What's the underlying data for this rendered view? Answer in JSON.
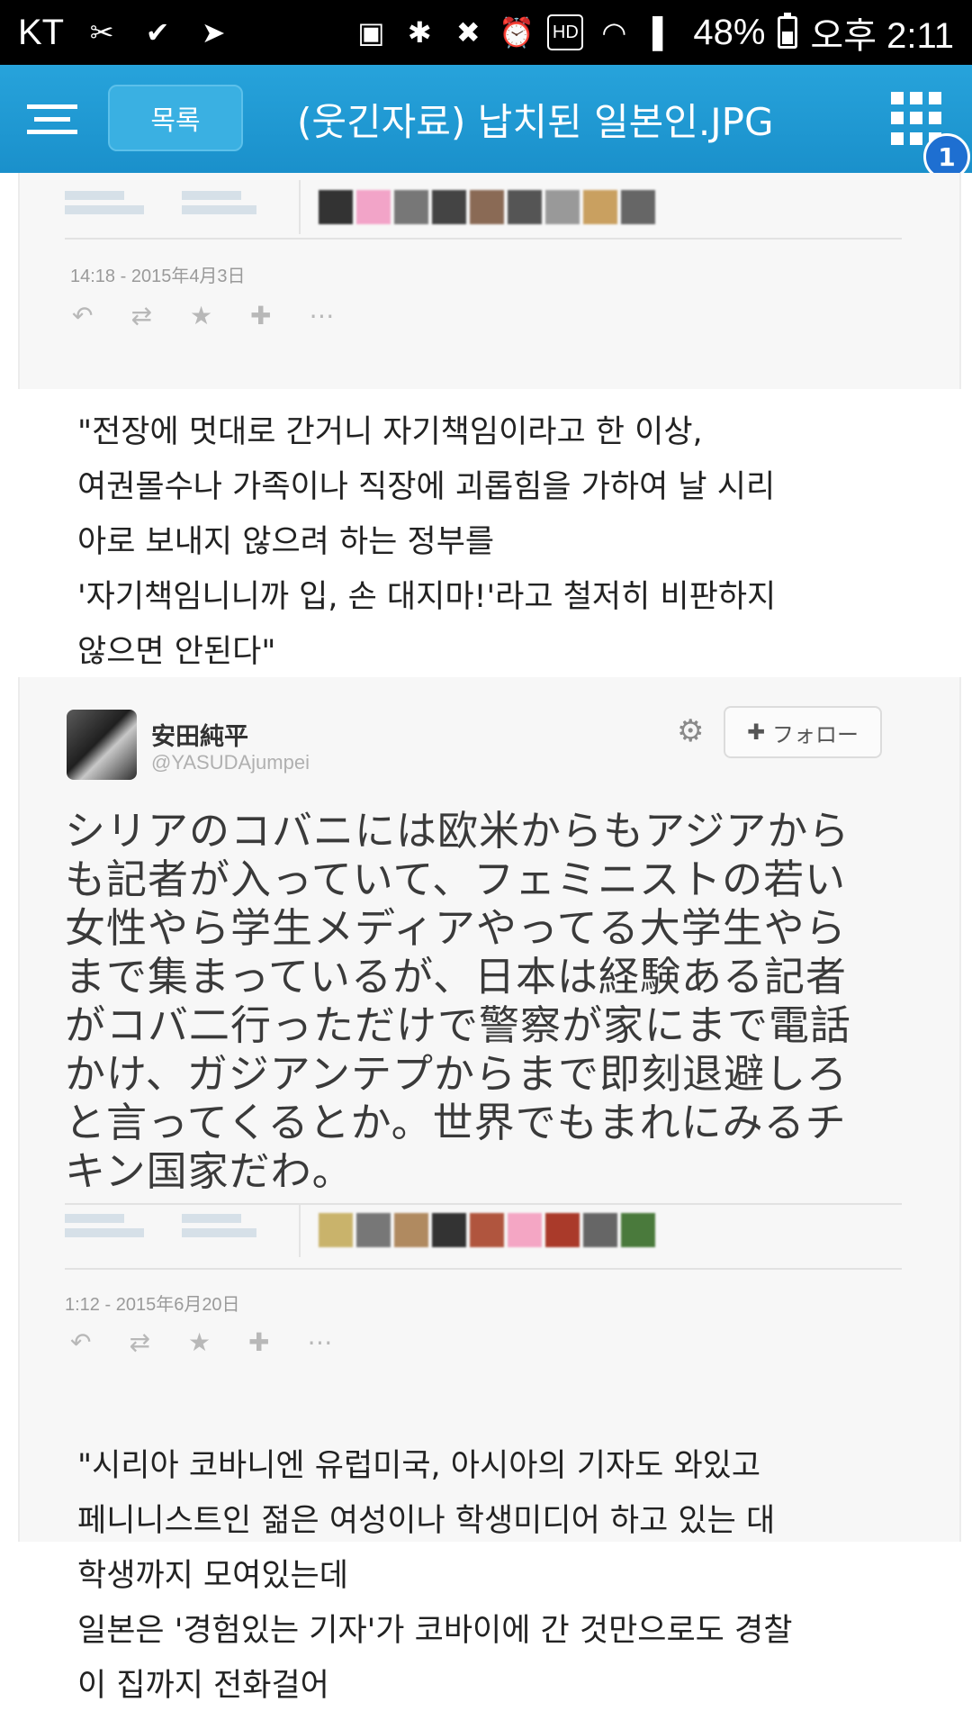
{
  "status_bar": {
    "carrier": "KT",
    "battery_percent": "48%",
    "battery_level": 0.48,
    "time": "오후 2:11",
    "left_icons": [
      "bandage-icon",
      "check-flag-icon",
      "bird-icon"
    ],
    "right_icons": [
      "sim-icon",
      "bluetooth-icon",
      "mute-icon",
      "alarm-icon",
      "hd-icon",
      "wifi-icon",
      "signal-icon"
    ],
    "hd_label": "HD"
  },
  "app_bar": {
    "list_label": "목록",
    "title": "(웃긴자료) 납치된 일본인.JPG",
    "badge_count": "1"
  },
  "tweet1": {
    "date": "14:18 - 2015年4月3日"
  },
  "translation1": {
    "text": "\"전장에 멋대로 간거니 자기책임이라고 한 이상,\n여권몰수나 가족이나 직장에 괴롭힘을 가하여 날 시리\n아로 보내지 않으려 하는 정부를\n'자기책임니니까 입, 손 대지마!'라고 철저히 비판하지\n않으면 안된다\""
  },
  "tweet2": {
    "name": "安田純平",
    "handle": "@YASUDAjumpei",
    "follow_label": "フォロー",
    "body": "シリアのコバニには欧米からもアジアから\nも記者が入っていて、フェミニストの若い\n女性やら学生メディアやってる大学生やら\nまで集まっているが、日本は経験ある記者\nがコバ二行っただけで警察が家にまで電話\nかけ、ガジアンテプからまで即刻退避しろ\nと言ってくるとか。世界でもまれにみるチ\nキン国家だわ。",
    "date": "1:12 - 2015年6月20日"
  },
  "translation2": {
    "text": "\"시리아 코바니엔 유럽미국, 아시아의 기자도 와있고\n페니니스트인 젊은 여성이나 학생미디어 하고 있는 대\n학생까지 모여있는데\n일본은 '경험있는 기자'가 코바이에 간 것만으로도 경찰\n이 집까지 전화걸어"
  },
  "colors": {
    "app_bar": "#1a90cb",
    "badge": "#1e6fd1"
  }
}
